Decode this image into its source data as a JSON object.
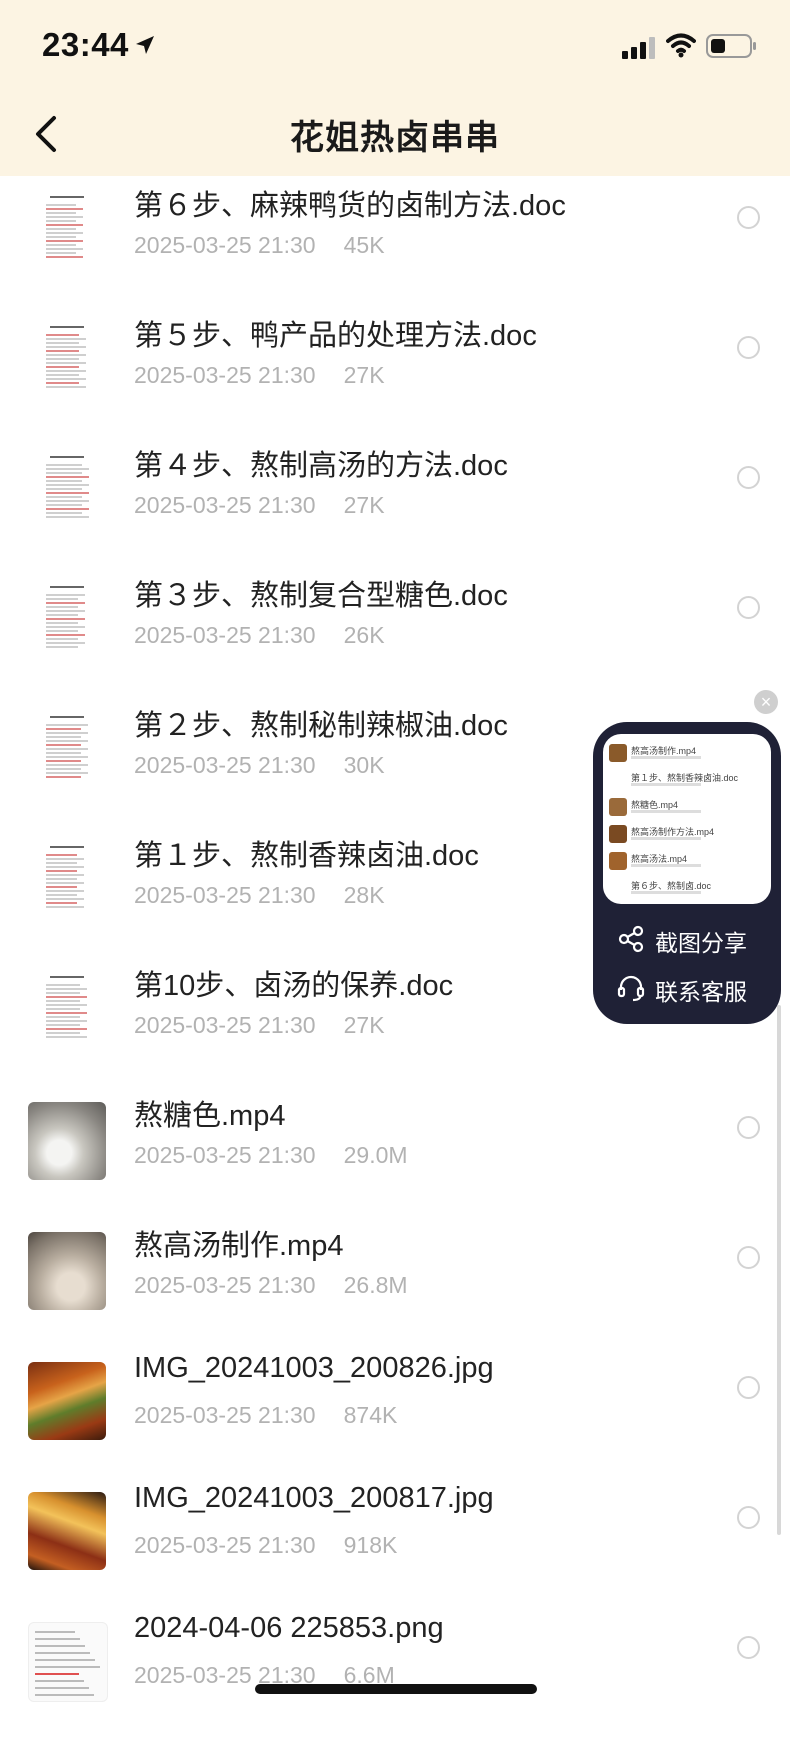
{
  "status_bar": {
    "time": "23:44"
  },
  "nav": {
    "title": "花姐热卤串串"
  },
  "files": [
    {
      "name": "第６步、麻辣鸭货的卤制方法.doc",
      "date": "2025-03-25 21:30",
      "size": "45K",
      "thumb": "doc"
    },
    {
      "name": "第５步、鸭产品的处理方法.doc",
      "date": "2025-03-25 21:30",
      "size": "27K",
      "thumb": "doc"
    },
    {
      "name": "第４步、熬制高汤的方法.doc",
      "date": "2025-03-25 21:30",
      "size": "27K",
      "thumb": "doc"
    },
    {
      "name": "第３步、熬制复合型糖色.doc",
      "date": "2025-03-25 21:30",
      "size": "26K",
      "thumb": "doc"
    },
    {
      "name": "第２步、熬制秘制辣椒油.doc",
      "date": "2025-03-25 21:30",
      "size": "30K",
      "thumb": "doc"
    },
    {
      "name": "第１步、熬制香辣卤油.doc",
      "date": "2025-03-25 21:30",
      "size": "28K",
      "thumb": "doc"
    },
    {
      "name": "第10步、卤汤的保养.doc",
      "date": "2025-03-25 21:30",
      "size": "27K",
      "thumb": "doc"
    },
    {
      "name": "熬糖色.mp4",
      "date": "2025-03-25 21:30",
      "size": "29.0M",
      "thumb": "candy"
    },
    {
      "name": "熬高汤制作.mp4",
      "date": "2025-03-25 21:30",
      "size": "26.8M",
      "thumb": "soup"
    },
    {
      "name": "IMG_20241003_200826.jpg",
      "date": "2025-03-25 21:30",
      "size": "874K",
      "thumb": "food1"
    },
    {
      "name": "IMG_20241003_200817.jpg",
      "date": "2025-03-25 21:30",
      "size": "918K",
      "thumb": "food2"
    },
    {
      "name": "2024-04-06 225853.png",
      "date": "2025-03-25 21:30",
      "size": "6.6M",
      "thumb": "screen"
    }
  ],
  "float_panel": {
    "share_label": "截图分享",
    "support_label": "联系客服",
    "preview_items": [
      "熬高汤制作.mp4",
      "第１步、熬制香辣卤油.doc",
      "熬糖色.mp4",
      "熬高汤制作方法.mp4",
      "熬高汤法.mp4",
      "第６步、熬制卤.doc"
    ]
  },
  "colors": {
    "header_bg": "#fcf4e3",
    "panel_bg": "#1f2136",
    "meta_text": "#b2b2b2"
  }
}
